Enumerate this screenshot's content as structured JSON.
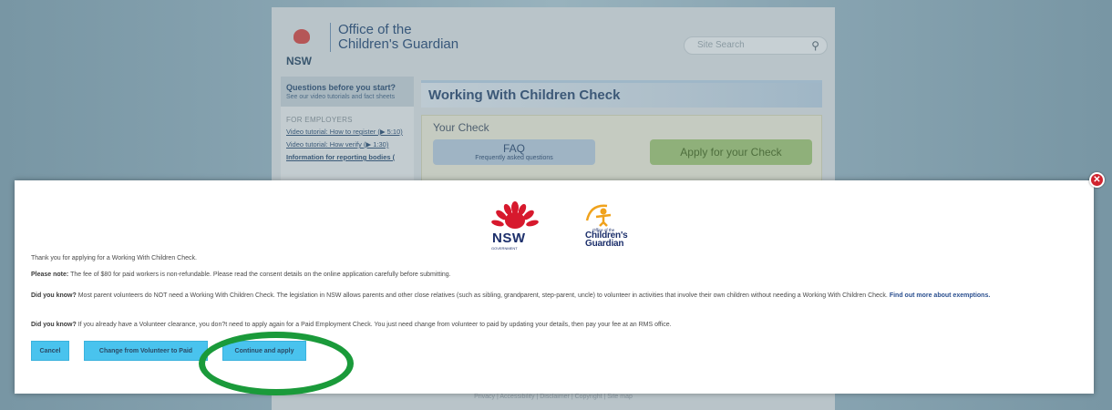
{
  "background_page": {
    "logo": {
      "nsw": "NSW",
      "agency_line1": "Office of the",
      "agency_line2": "Children's Guardian"
    },
    "search": {
      "placeholder": "Site Search",
      "icon": "search-icon"
    },
    "sidebar": {
      "questions_title": "Questions before you start?",
      "questions_sub": "See our video tutorials and fact sheets",
      "section_label": "FOR EMPLOYERS",
      "links": [
        "Video tutorial: How to register (▶ 5:10)",
        "Video tutorial: How verify (▶ 1:30)",
        "Information for reporting bodies ("
      ]
    },
    "title": "Working With Children Check",
    "your_check": {
      "heading": "Your Check",
      "faq_label": "FAQ",
      "faq_sub": "Frequently asked questions",
      "apply_label": "Apply for your Check"
    },
    "footer": "Privacy | Accessibility | Disclaimer | Copyright | Site map"
  },
  "modal": {
    "close_icon": "close-icon",
    "logo_nsw": {
      "text": "NSW",
      "sub": "GOVERNMENT"
    },
    "logo_ocg": {
      "small": "Office of the",
      "line1": "Children's",
      "line2": "Guardian"
    },
    "intro": "Thank you for applying for a Working With Children Check.",
    "note_label": "Please note:",
    "note_text": " The fee of $80 for paid workers is non-refundable. Please read the consent details on the online application carefully before submitting.",
    "dyk1_label": "Did you know?",
    "dyk1_text": " Most parent volunteers do NOT need a Working With Children Check. The legislation in NSW allows parents and other close relatives (such as sibling, grandparent, step-parent, uncle) to volunteer in activities that involve their own children without needing a Working With Children Check. ",
    "dyk1_link": "Find out more about exemptions.",
    "dyk2_label": "Did you know?",
    "dyk2_text": " If you already have a Volunteer clearance, you don?t need to apply again for a Paid Employment Check. You just need change from volunteer to paid by updating your details, then pay your fee at an RMS office.",
    "buttons": {
      "cancel": "Cancel",
      "change": "Change from Volunteer to Paid",
      "continue": "Continue and apply"
    }
  },
  "colors": {
    "accent_button": "#49c3ee",
    "close_red": "#d0232e",
    "annotation_green": "#1a9a3a"
  }
}
